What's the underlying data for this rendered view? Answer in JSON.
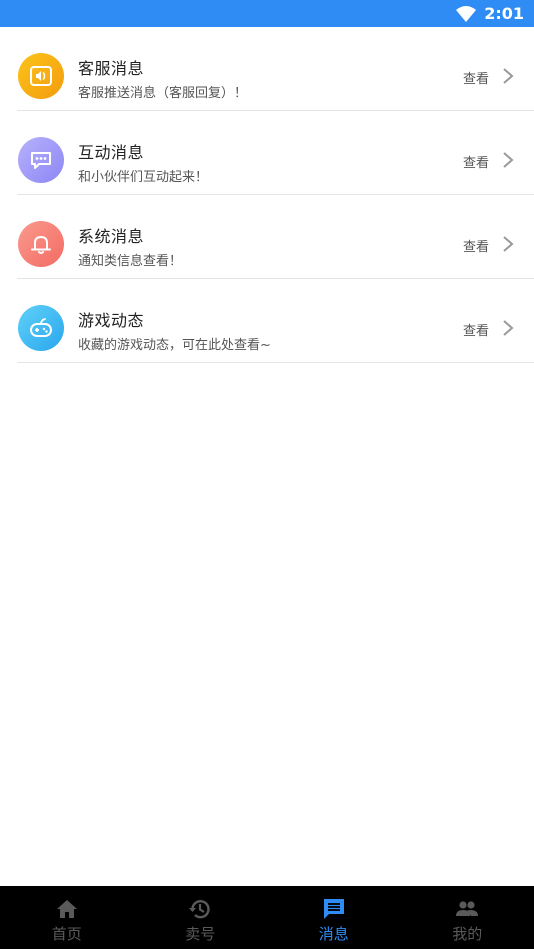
{
  "status_bar": {
    "time": "2:01",
    "icon": "wifi-icon"
  },
  "messages": [
    {
      "title": "客服消息",
      "subtitle": "客服推送消息（客服回复）！",
      "action": "查看",
      "icon": "speaker-icon",
      "color_from": "#fcc41a",
      "color_to": "#f39b0e"
    },
    {
      "title": "互动消息",
      "subtitle": "和小伙伴们互动起来！",
      "action": "查看",
      "icon": "chat-bubble-icon",
      "color_from": "#b6b2fb",
      "color_to": "#8d86f5"
    },
    {
      "title": "系统消息",
      "subtitle": "通知类信息查看！",
      "action": "查看",
      "icon": "bell-icon",
      "color_from": "#fb9a8e",
      "color_to": "#f26b63"
    },
    {
      "title": "游戏动态",
      "subtitle": "收藏的游戏动态，可在此处查看~",
      "action": "查看",
      "icon": "gamepad-icon",
      "color_from": "#5fd1f8",
      "color_to": "#2aa6ee"
    }
  ],
  "bottom_nav": [
    {
      "label": "首页",
      "icon": "home-icon",
      "active": false
    },
    {
      "label": "卖号",
      "icon": "history-icon",
      "active": false
    },
    {
      "label": "消息",
      "icon": "message-icon",
      "active": true
    },
    {
      "label": "我的",
      "icon": "people-icon",
      "active": false
    }
  ],
  "colors": {
    "accent": "#2f8cf4",
    "nav_background": "#000000",
    "nav_inactive": "#5a5a5a"
  }
}
